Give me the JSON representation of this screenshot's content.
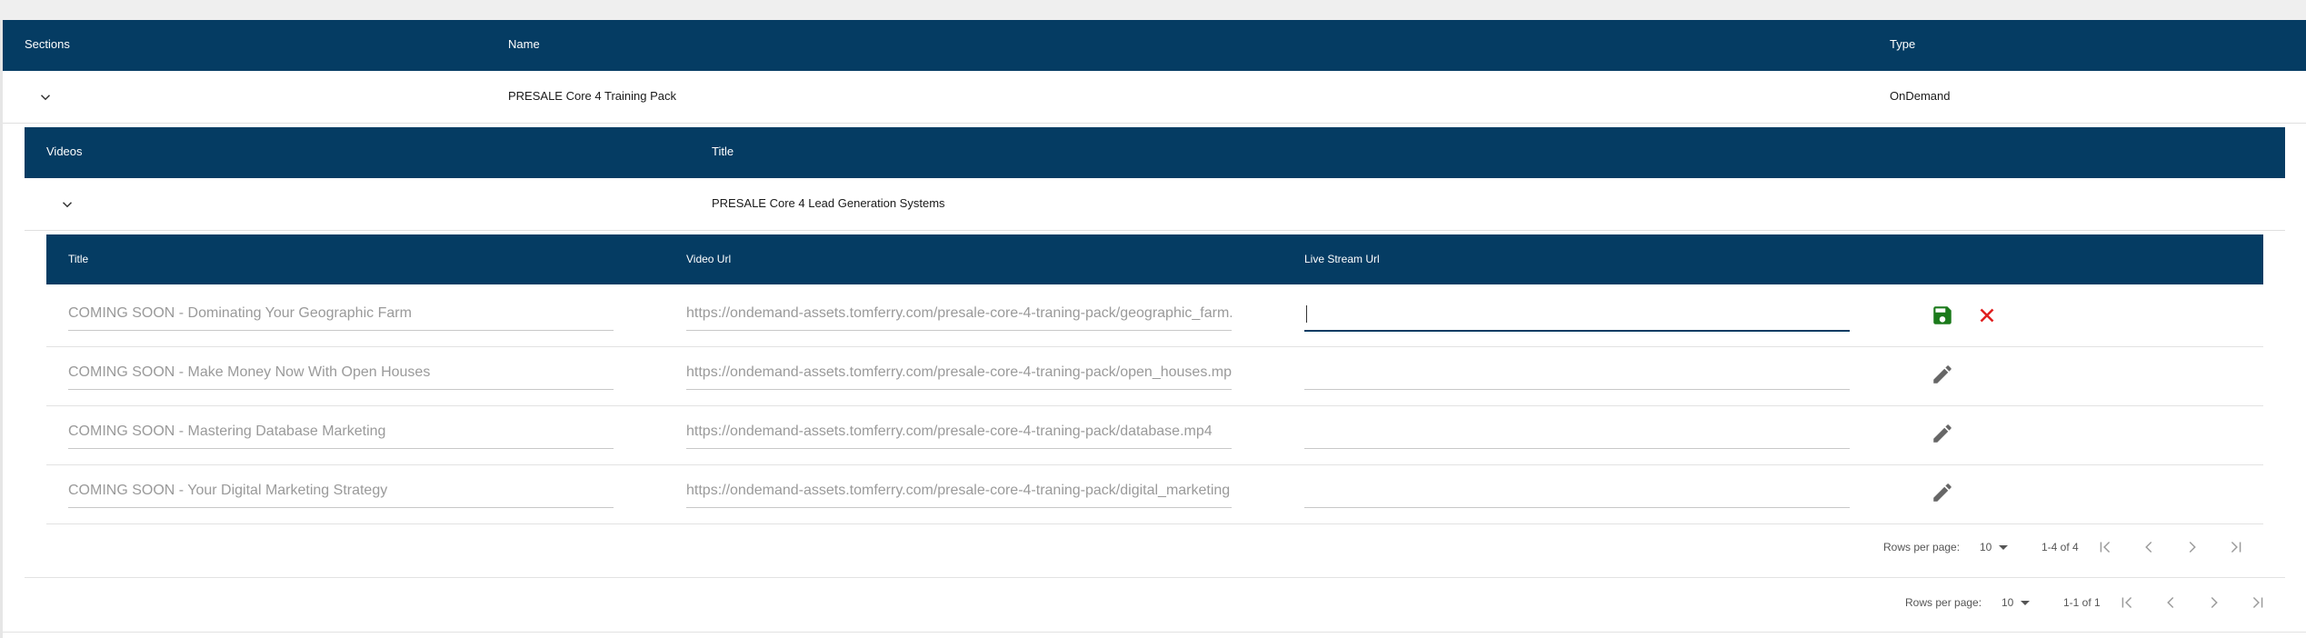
{
  "sections_table": {
    "headers": {
      "sections": "Sections",
      "name": "Name",
      "type": "Type"
    },
    "rows": [
      {
        "name": "PRESALE Core 4 Training Pack",
        "type": "OnDemand"
      }
    ],
    "pagination": {
      "rows_per_page_label": "Rows per page:",
      "rows_per_page": "10",
      "range": "1-1 of 1"
    }
  },
  "videos_table": {
    "headers": {
      "videos": "Videos",
      "title": "Title"
    },
    "rows": [
      {
        "title": "PRESALE Core 4 Lead Generation Systems"
      }
    ]
  },
  "lessons_table": {
    "headers": {
      "title": "Title",
      "video_url": "Video Url",
      "live_stream_url": "Live Stream Url"
    },
    "rows": [
      {
        "title": "COMING SOON - Dominating Your Geographic Farm",
        "video_url": "https://ondemand-assets.tomferry.com/presale-core-4-traning-pack/geographic_farm.",
        "live_stream_url": "",
        "editing": true
      },
      {
        "title": "COMING SOON - Make Money Now With Open Houses",
        "video_url": "https://ondemand-assets.tomferry.com/presale-core-4-traning-pack/open_houses.mp",
        "live_stream_url": ""
      },
      {
        "title": "COMING SOON - Mastering Database Marketing",
        "video_url": "https://ondemand-assets.tomferry.com/presale-core-4-traning-pack/database.mp4",
        "live_stream_url": ""
      },
      {
        "title": "COMING SOON - Your Digital Marketing Strategy",
        "video_url": "https://ondemand-assets.tomferry.com/presale-core-4-traning-pack/digital_marketing",
        "live_stream_url": ""
      }
    ],
    "pagination": {
      "rows_per_page_label": "Rows per page:",
      "rows_per_page": "10",
      "range": "1-4 of 4"
    }
  },
  "icons": {
    "expand": "chevron-down-icon",
    "save": "save-icon",
    "cancel": "close-icon",
    "edit": "pencil-icon",
    "first_page": "first-page-icon",
    "prev_page": "chevron-left-icon",
    "next_page": "chevron-right-icon",
    "last_page": "last-page-icon"
  },
  "colors": {
    "header_bg": "#053c63",
    "save": "#1b7a1b",
    "cancel": "#e02020",
    "edit": "#666666",
    "page_bg": "#ffffff"
  }
}
